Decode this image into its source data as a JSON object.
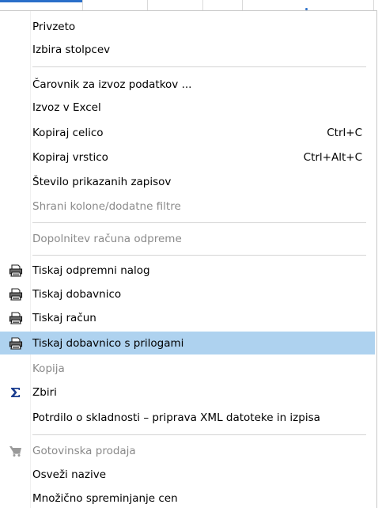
{
  "menu": {
    "items": [
      {
        "label": "Privzeto",
        "shortcut": "",
        "enabled": true
      },
      {
        "label": "Izbira stolpcev",
        "shortcut": "",
        "enabled": true
      },
      {
        "label": "Čarovnik za izvoz podatkov ...",
        "shortcut": "",
        "enabled": true
      },
      {
        "label": "Izvoz v Excel",
        "shortcut": "",
        "enabled": true
      },
      {
        "label": "Kopiraj celico",
        "shortcut": "Ctrl+C",
        "enabled": true
      },
      {
        "label": "Kopiraj vrstico",
        "shortcut": "Ctrl+Alt+C",
        "enabled": true
      },
      {
        "label": "Število prikazanih zapisov",
        "shortcut": "",
        "enabled": true
      },
      {
        "label": "Shrani kolone/dodatne filtre",
        "shortcut": "",
        "enabled": false
      },
      {
        "label": "Dopolnitev računa odpreme",
        "shortcut": "",
        "enabled": false
      },
      {
        "label": "Tiskaj odpremni nalog",
        "shortcut": "",
        "enabled": true,
        "icon": "printer-icon"
      },
      {
        "label": "Tiskaj dobavnico",
        "shortcut": "",
        "enabled": true,
        "icon": "printer-icon"
      },
      {
        "label": "Tiskaj račun",
        "shortcut": "",
        "enabled": true,
        "icon": "printer-icon"
      },
      {
        "label": "Tiskaj dobavnico s prilogami",
        "shortcut": "",
        "enabled": true,
        "icon": "printer-icon",
        "highlighted": true
      },
      {
        "label": "Kopija",
        "shortcut": "",
        "enabled": false
      },
      {
        "label": "Zbiri",
        "shortcut": "",
        "enabled": true,
        "icon": "sigma-icon"
      },
      {
        "label": "Potrdilo o skladnosti – priprava XML datoteke in izpisa",
        "shortcut": "",
        "enabled": true
      },
      {
        "label": "Gotovinska prodaja",
        "shortcut": "",
        "enabled": false,
        "icon": "cart-icon"
      },
      {
        "label": "Osveži nazive",
        "shortcut": "",
        "enabled": true
      },
      {
        "label": "Množično spreminjanje cen",
        "shortcut": "",
        "enabled": true
      }
    ]
  },
  "colors": {
    "highlight": "#aed2ef",
    "disabled_text": "#8a8a8a",
    "accent": "#2a6fc9"
  }
}
